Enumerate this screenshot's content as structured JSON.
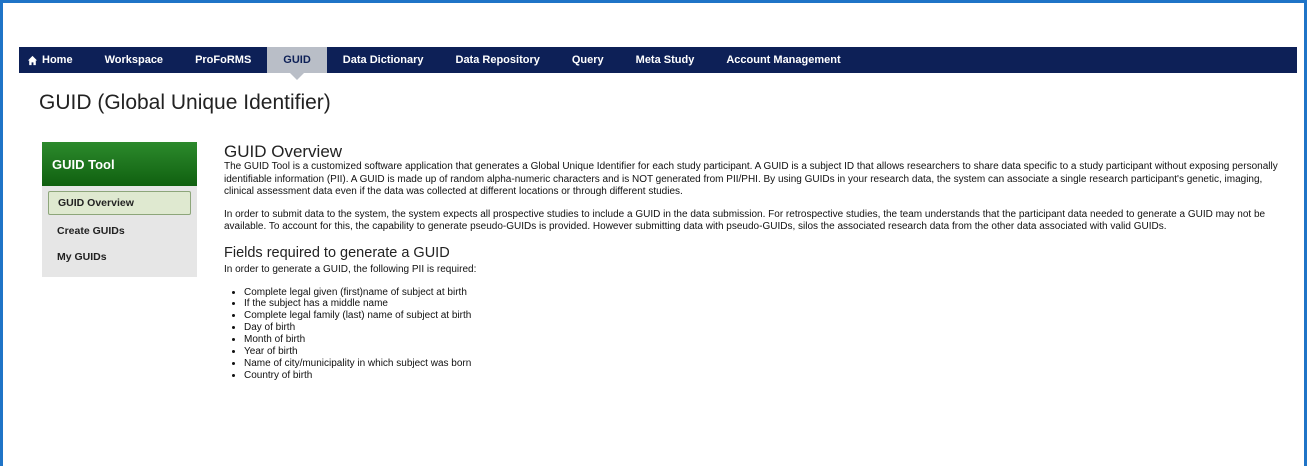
{
  "nav": {
    "items": [
      {
        "label": "Home",
        "icon": "home-icon"
      },
      {
        "label": "Workspace"
      },
      {
        "label": "ProFoRMS"
      },
      {
        "label": "GUID",
        "active": true
      },
      {
        "label": "Data Dictionary"
      },
      {
        "label": "Data Repository"
      },
      {
        "label": "Query"
      },
      {
        "label": "Meta Study"
      },
      {
        "label": "Account Management"
      }
    ]
  },
  "page": {
    "title": "GUID (Global Unique Identifier)"
  },
  "sidebar": {
    "header": "GUID Tool",
    "items": [
      {
        "label": "GUID Overview",
        "active": true
      },
      {
        "label": "Create GUIDs"
      },
      {
        "label": "My GUIDs"
      }
    ]
  },
  "content": {
    "overview_heading": "GUID Overview",
    "overview_para1": "The GUID Tool is a customized software application that generates a Global Unique Identifier for each study participant. A GUID is a subject ID that allows researchers to share data specific to a study participant without exposing personally identifiable information (PII). A GUID is made up of random alpha-numeric characters and is NOT generated from PII/PHI. By using GUIDs in your research data, the system can associate a single research participant's genetic, imaging, clinical assessment data even if the data was collected at different locations or through different studies.",
    "overview_para2": "In order to submit data to the system, the system expects all prospective studies to include a GUID in the data submission. For retrospective studies, the team understands that the participant data needed to generate a GUID may not be available. To account for this, the capability to generate pseudo-GUIDs is provided. However submitting data with pseudo-GUIDs, silos the associated research data from the other data associated with valid GUIDs.",
    "fields_heading": "Fields required to generate a GUID",
    "fields_intro": "In order to generate a GUID, the following PII is required:",
    "fields": [
      "Complete legal given (first)name of subject at birth",
      "If the subject has a middle name",
      "Complete legal family (last) name of subject at birth",
      "Day of birth",
      "Month of birth",
      "Year of birth",
      "Name of city/municipality in which subject was born",
      "Country of birth"
    ]
  },
  "colors": {
    "frame_border": "#1f74c7",
    "navbar_bg": "#0d2057",
    "nav_active_bg": "#b9bec7",
    "sidebar_header_green": "#1a7a1a",
    "sidebar_bg": "#e6e6e6",
    "sidebar_active_bg": "#dfe9d0"
  }
}
